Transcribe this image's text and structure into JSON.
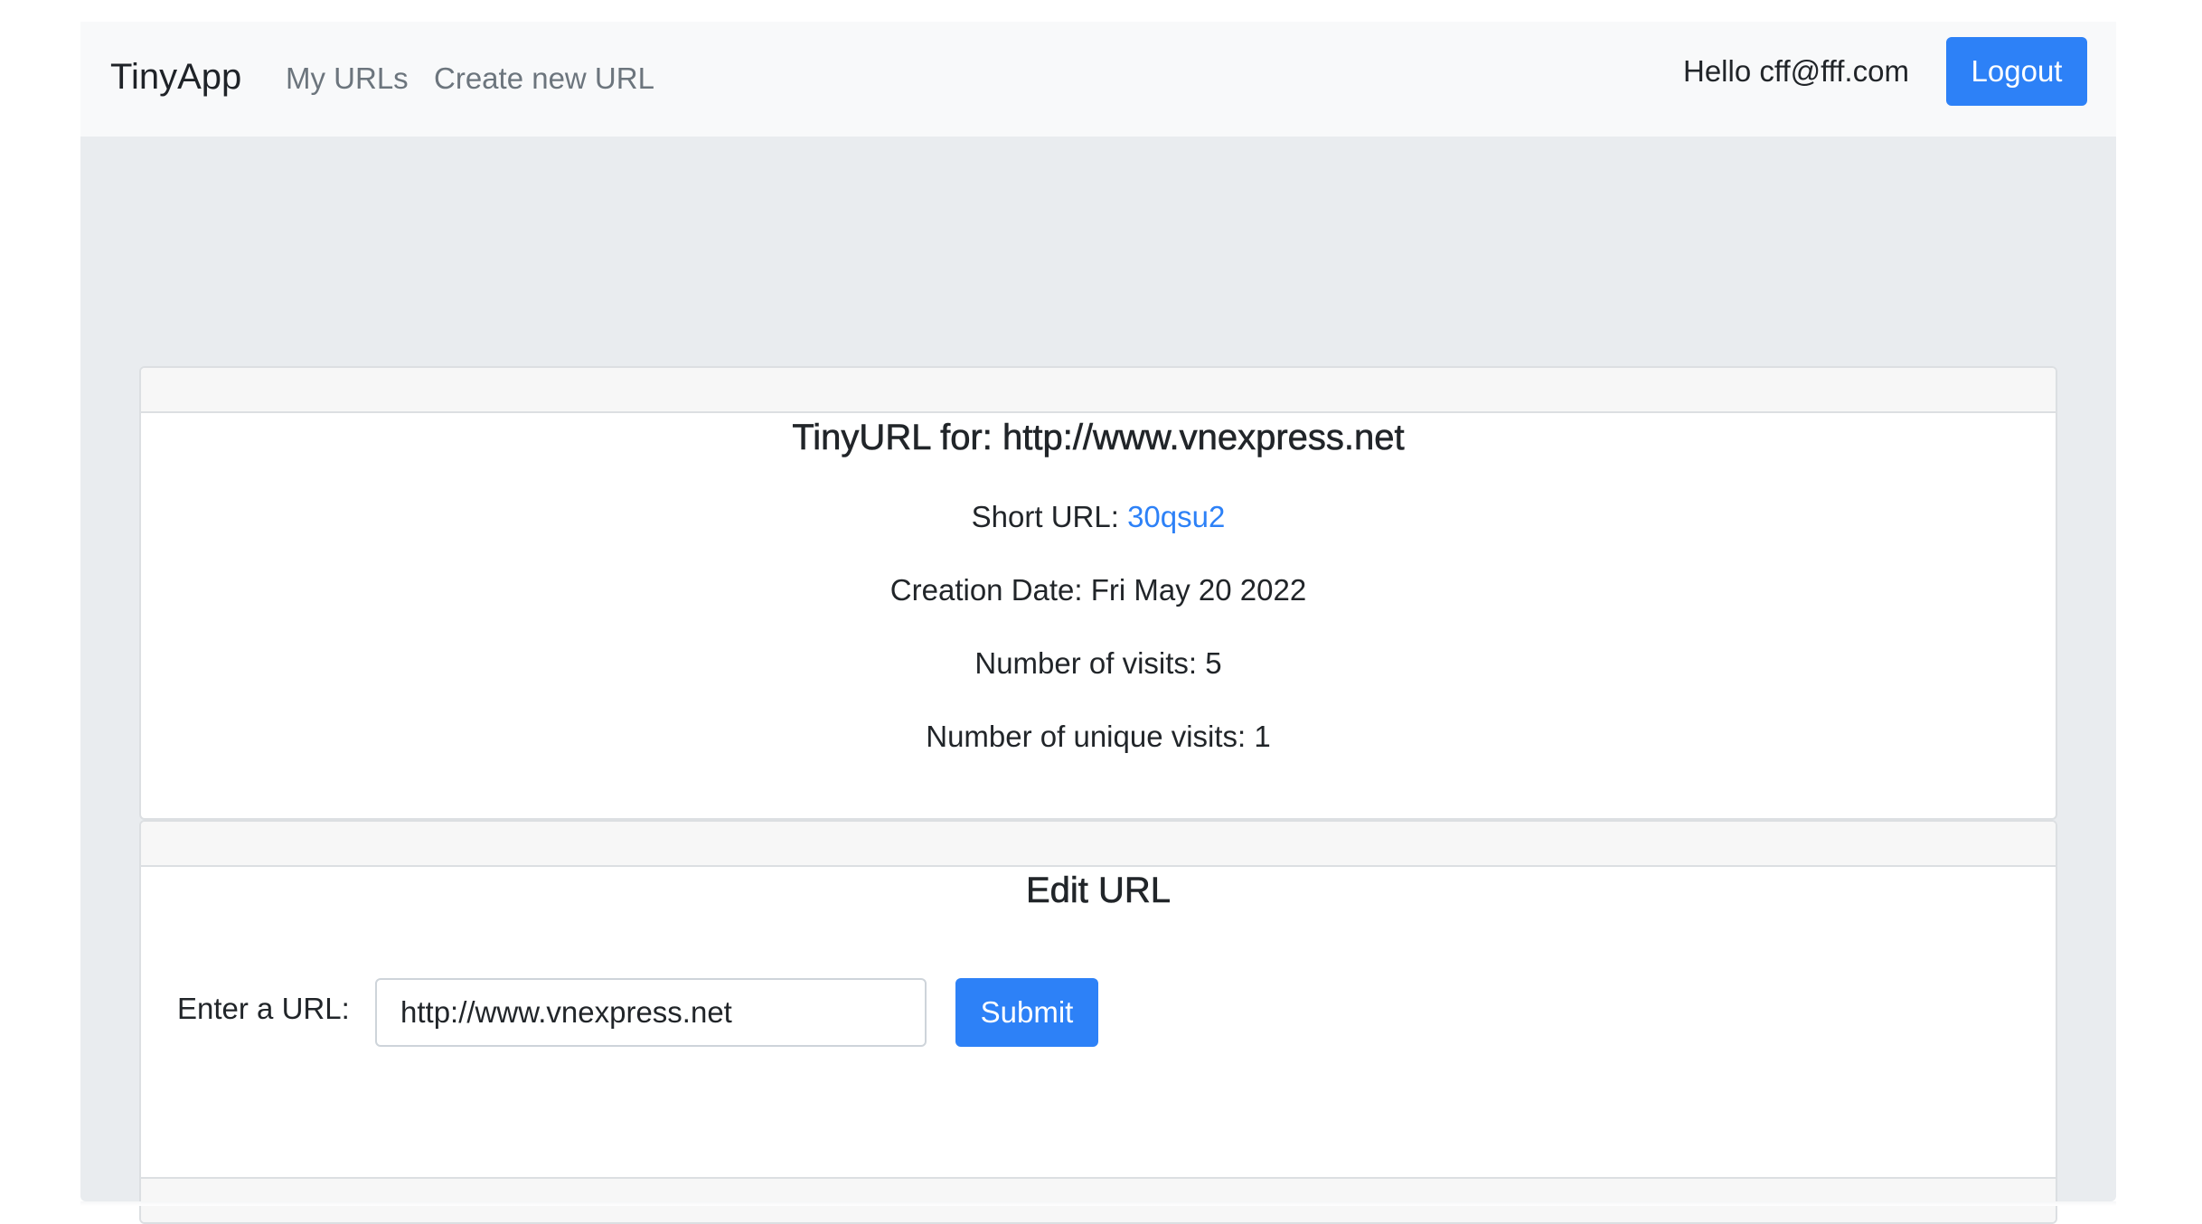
{
  "navbar": {
    "brand": "TinyApp",
    "links": [
      "My URLs",
      "Create new URL"
    ],
    "greeting": "Hello cff@fff.com",
    "logout_label": "Logout"
  },
  "url_details": {
    "title": "TinyURL for: http://www.vnexpress.net",
    "short_url_label": "Short URL: ",
    "short_url": "30qsu2",
    "creation_date": "Creation Date: Fri May 20 2022",
    "visits": "Number of visits: 5",
    "unique_visits": "Number of unique visits: 1"
  },
  "edit_form": {
    "title": "Edit URL",
    "label": "Enter a URL:",
    "input_value": "http://www.vnexpress.net",
    "submit_label": "Submit"
  },
  "colors": {
    "primary": "#2d81f7",
    "navbar_bg": "#f8f9fa",
    "jumbotron_bg": "#e9ecef"
  }
}
